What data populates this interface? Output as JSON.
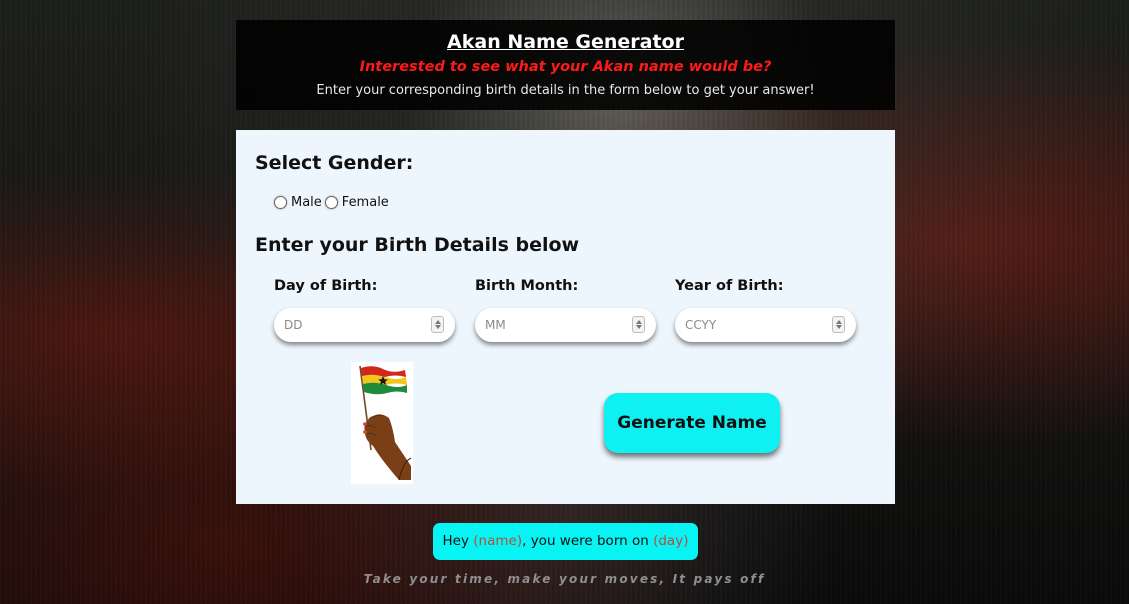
{
  "header": {
    "title": "Akan Name Generator",
    "subtitle": "Interested to see what your Akan name would be?",
    "instructions": "Enter your corresponding birth details in the form below to get your answer!"
  },
  "form": {
    "gender_heading": "Select Gender:",
    "gender_options": [
      "Male",
      "Female"
    ],
    "birth_heading": "Enter your Birth Details below",
    "fields": [
      {
        "label": "Day of Birth:",
        "placeholder": "DD"
      },
      {
        "label": "Birth Month:",
        "placeholder": "MM"
      },
      {
        "label": "Year of Birth:",
        "placeholder": "CCYY"
      }
    ],
    "generate_label": "Generate Name"
  },
  "result": {
    "prefix": "Hey ",
    "name_placeholder": "(name)",
    "middle": ", you were born on ",
    "day_placeholder": "(day)"
  },
  "footer": {
    "quote": "Take your time, make your moves, It pays off"
  },
  "colors": {
    "accent_cyan": "#0ff0f2",
    "subtitle_red": "#ff1a1a",
    "card_background": "#eef6fd"
  },
  "icons": {
    "flag": "ghana-flag-in-hand-image"
  }
}
